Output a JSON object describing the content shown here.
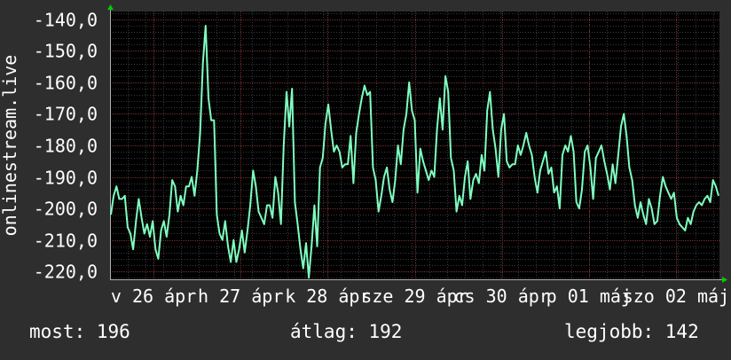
{
  "chart_data": {
    "type": "line",
    "ylabel": "onlinestream.live",
    "ylim": [
      -222.5,
      -137.5
    ],
    "y_ticks": [
      -140,
      -150,
      -160,
      -170,
      -180,
      -190,
      -200,
      -210,
      -220
    ],
    "y_tick_labels": [
      "-140,0",
      "-150,0",
      "-160,0",
      "-170,0",
      "-180,0",
      "-190,0",
      "-200,0",
      "-210,0",
      "-220,0"
    ],
    "x_tick_labels": [
      "v 26 ápr",
      "h 27 ápr",
      "k 28 ápr",
      "sze 29 ápr",
      "cs 30 ápr",
      "p 01 máj",
      "szo 02 máj"
    ],
    "grid": true,
    "series_color": "#7fffc0",
    "series": [
      {
        "values": [
          -202,
          -196,
          -193,
          -197,
          -197,
          -196,
          -206,
          -208,
          -213,
          -204,
          -197,
          -203,
          -208,
          -205,
          -209,
          -204,
          -213,
          -216,
          -207,
          -204,
          -209,
          -202,
          -191,
          -193,
          -201,
          -196,
          -199,
          -193,
          -193,
          -190,
          -196,
          -188,
          -176,
          -154,
          -142,
          -165,
          -172,
          -172,
          -202,
          -208,
          -210,
          -204,
          -212,
          -217,
          -210,
          -217,
          -213,
          -207,
          -214,
          -207,
          -199,
          -188,
          -193,
          -201,
          -203,
          -205,
          -199,
          -199,
          -203,
          -190,
          -195,
          -205,
          -180,
          -163,
          -174,
          -162,
          -198,
          -205,
          -213,
          -219,
          -211,
          -222,
          -212,
          -199,
          -212,
          -187,
          -184,
          -173,
          -167,
          -175,
          -182,
          -180,
          -182,
          -187,
          -186,
          -186,
          -177,
          -192,
          -176,
          -170,
          -165,
          -161,
          -164,
          -163,
          -187,
          -191,
          -201,
          -196,
          -190,
          -187,
          -194,
          -198,
          -191,
          -180,
          -186,
          -175,
          -170,
          -160,
          -169,
          -172,
          -195,
          -181,
          -185,
          -188,
          -191,
          -188,
          -190,
          -175,
          -165,
          -175,
          -158,
          -163,
          -184,
          -188,
          -201,
          -196,
          -199,
          -190,
          -185,
          -197,
          -191,
          -189,
          -192,
          -183,
          -188,
          -169,
          -163,
          -175,
          -181,
          -190,
          -175,
          -170,
          -185,
          -187,
          -186,
          -186,
          -180,
          -183,
          -180,
          -176,
          -180,
          -183,
          -190,
          -195,
          -188,
          -185,
          -182,
          -189,
          -187,
          -195,
          -193,
          -200,
          -183,
          -180,
          -182,
          -177,
          -182,
          -198,
          -200,
          -194,
          -182,
          -180,
          -187,
          -197,
          -184,
          -182,
          -180,
          -185,
          -189,
          -194,
          -186,
          -192,
          -183,
          -174,
          -170,
          -177,
          -187,
          -191,
          -199,
          -203,
          -198,
          -202,
          -205,
          -197,
          -200,
          -205,
          -204,
          -196,
          -190,
          -193,
          -195,
          -197,
          -195,
          -203,
          -205,
          -206,
          -207,
          -203,
          -205,
          -201,
          -199,
          -198,
          -199,
          -197,
          -196,
          -198,
          -191,
          -193,
          -196
        ]
      }
    ]
  },
  "stats": {
    "now": "most: 196",
    "avg": "átlag: 192",
    "best": "legjobb: 142"
  }
}
